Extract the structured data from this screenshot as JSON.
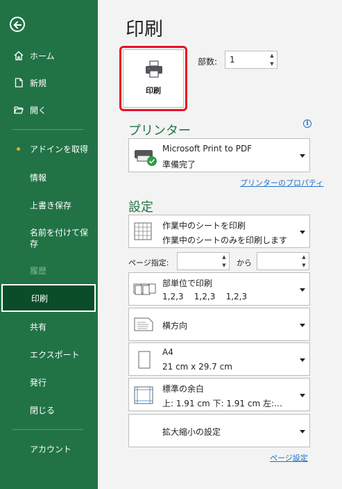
{
  "sidebar": {
    "items": [
      {
        "label": "ホーム"
      },
      {
        "label": "新規"
      },
      {
        "label": "開く"
      },
      {
        "label": "アドインを取得"
      },
      {
        "label": "情報"
      },
      {
        "label": "上書き保存"
      },
      {
        "label": "名前を付けて保存"
      },
      {
        "label": "履歴"
      },
      {
        "label": "印刷"
      },
      {
        "label": "共有"
      },
      {
        "label": "エクスポート"
      },
      {
        "label": "発行"
      },
      {
        "label": "閉じる"
      },
      {
        "label": "アカウント"
      }
    ]
  },
  "main": {
    "title": "印刷",
    "print_button_label": "印刷",
    "copies_label": "部数:",
    "copies_value": "1",
    "printer_section": "プリンター",
    "printer": {
      "name": "Microsoft Print to PDF",
      "status": "準備完了"
    },
    "printer_properties_link": "プリンターのプロパティ",
    "settings_section": "設定",
    "settings": [
      {
        "line1": "作業中のシートを印刷",
        "line2": "作業中のシートのみを印刷します"
      },
      {
        "line1": "部単位で印刷",
        "line2": "1,2,3    1,2,3    1,2,3"
      },
      {
        "line1": "横方向",
        "line2": ""
      },
      {
        "line1": "A4",
        "line2": "21 cm x 29.7 cm"
      },
      {
        "line1": "標準の余白",
        "line2": "上: 1.91 cm 下: 1.91 cm 左:…"
      },
      {
        "line1": "拡大縮小の設定",
        "line2": ""
      }
    ],
    "pages_label": "ページ指定:",
    "pages_to_label": "から",
    "page_setup_link": "ページ設定"
  },
  "colors": {
    "accent": "#217346",
    "active_nav": "#0b4d28",
    "highlight": "#e81123",
    "link": "#1e6fc9"
  }
}
